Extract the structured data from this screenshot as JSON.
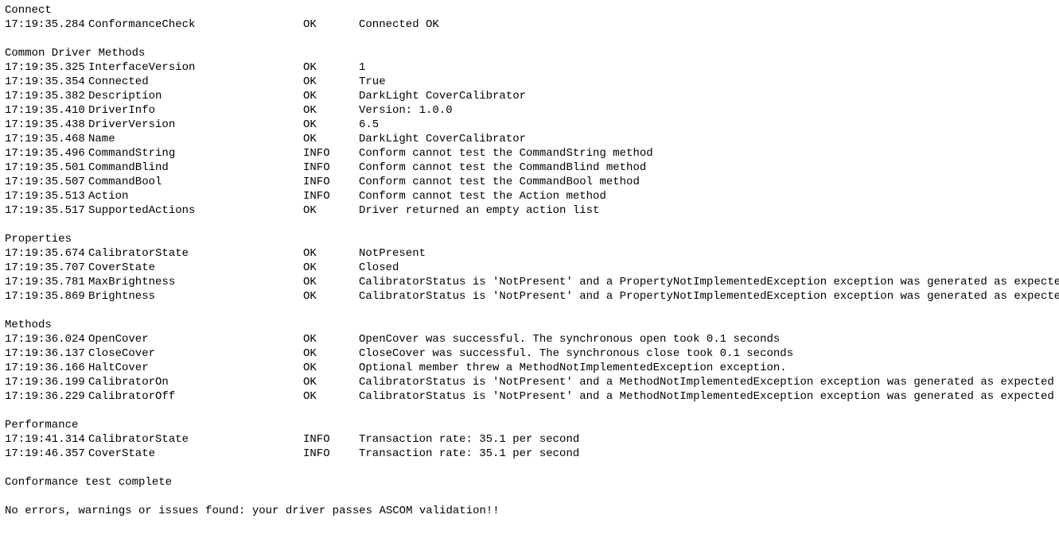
{
  "sections": [
    {
      "header": "Connect",
      "rows": [
        {
          "ts": "17:19:35.284",
          "name": "ConformanceCheck",
          "status": "OK",
          "msg": "Connected OK"
        }
      ]
    },
    {
      "header": "Common Driver Methods",
      "rows": [
        {
          "ts": "17:19:35.325",
          "name": "InterfaceVersion",
          "status": "OK",
          "msg": "1"
        },
        {
          "ts": "17:19:35.354",
          "name": "Connected",
          "status": "OK",
          "msg": "True"
        },
        {
          "ts": "17:19:35.382",
          "name": "Description",
          "status": "OK",
          "msg": "DarkLight CoverCalibrator"
        },
        {
          "ts": "17:19:35.410",
          "name": "DriverInfo",
          "status": "OK",
          "msg": "Version: 1.0.0"
        },
        {
          "ts": "17:19:35.438",
          "name": "DriverVersion",
          "status": "OK",
          "msg": "6.5"
        },
        {
          "ts": "17:19:35.468",
          "name": "Name",
          "status": "OK",
          "msg": "DarkLight CoverCalibrator"
        },
        {
          "ts": "17:19:35.496",
          "name": "CommandString",
          "status": "INFO",
          "msg": "Conform cannot test the CommandString method"
        },
        {
          "ts": "17:19:35.501",
          "name": "CommandBlind",
          "status": "INFO",
          "msg": "Conform cannot test the CommandBlind method"
        },
        {
          "ts": "17:19:35.507",
          "name": "CommandBool",
          "status": "INFO",
          "msg": "Conform cannot test the CommandBool method"
        },
        {
          "ts": "17:19:35.513",
          "name": "Action",
          "status": "INFO",
          "msg": "Conform cannot test the Action method"
        },
        {
          "ts": "17:19:35.517",
          "name": "SupportedActions",
          "status": "OK",
          "msg": "Driver returned an empty action list"
        }
      ]
    },
    {
      "header": "Properties",
      "rows": [
        {
          "ts": "17:19:35.674",
          "name": "CalibratorState",
          "status": "OK",
          "msg": "NotPresent"
        },
        {
          "ts": "17:19:35.707",
          "name": "CoverState",
          "status": "OK",
          "msg": "Closed"
        },
        {
          "ts": "17:19:35.781",
          "name": "MaxBrightness",
          "status": "OK",
          "msg": "CalibratorStatus is 'NotPresent' and a PropertyNotImplementedException exception was generated as expected"
        },
        {
          "ts": "17:19:35.869",
          "name": "Brightness",
          "status": "OK",
          "msg": "CalibratorStatus is 'NotPresent' and a PropertyNotImplementedException exception was generated as expected"
        }
      ]
    },
    {
      "header": "Methods",
      "rows": [
        {
          "ts": "17:19:36.024",
          "name": "OpenCover",
          "status": "OK",
          "msg": "OpenCover was successful. The synchronous open took 0.1 seconds"
        },
        {
          "ts": "17:19:36.137",
          "name": "CloseCover",
          "status": "OK",
          "msg": "CloseCover was successful. The synchronous close took 0.1 seconds"
        },
        {
          "ts": "17:19:36.166",
          "name": "HaltCover",
          "status": "OK",
          "msg": "Optional member threw a MethodNotImplementedException exception."
        },
        {
          "ts": "17:19:36.199",
          "name": "CalibratorOn",
          "status": "OK",
          "msg": "CalibratorStatus is 'NotPresent' and a MethodNotImplementedException exception was generated as expected"
        },
        {
          "ts": "17:19:36.229",
          "name": "CalibratorOff",
          "status": "OK",
          "msg": "CalibratorStatus is 'NotPresent' and a MethodNotImplementedException exception was generated as expected"
        }
      ]
    },
    {
      "header": "Performance",
      "rows": [
        {
          "ts": "17:19:41.314",
          "name": "CalibratorState",
          "status": "INFO",
          "msg": "Transaction rate: 35.1 per second"
        },
        {
          "ts": "17:19:46.357",
          "name": "CoverState",
          "status": "INFO",
          "msg": "Transaction rate: 35.1 per second"
        }
      ]
    }
  ],
  "footer": {
    "complete": "Conformance test complete",
    "summary": "No errors, warnings or issues found: your driver passes ASCOM validation!!"
  }
}
